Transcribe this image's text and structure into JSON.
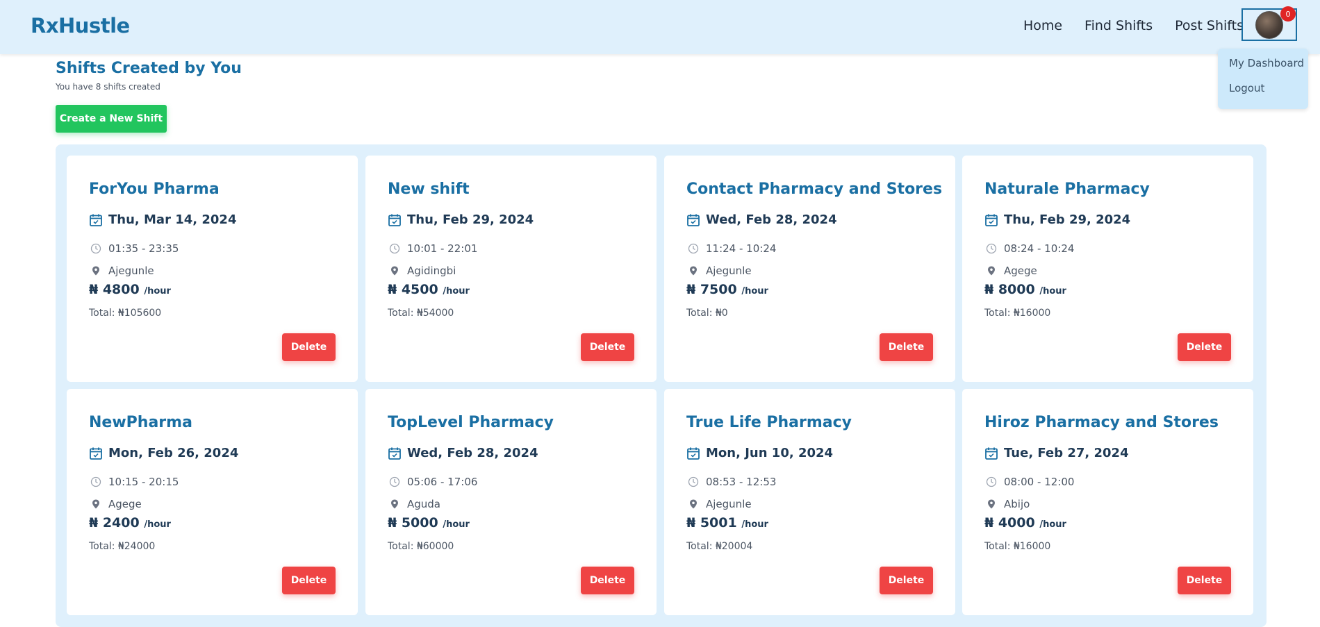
{
  "brand": "RxHustle",
  "nav": {
    "links": [
      "Home",
      "Find Shifts",
      "Post Shifts"
    ],
    "notification_count": "0"
  },
  "dropdown": {
    "items": [
      "My Dashboard",
      "Logout"
    ]
  },
  "page": {
    "title": "Shifts Created by You",
    "subtitle": "You have 8 shifts created",
    "create_button": "Create a New Shift"
  },
  "card_labels": {
    "per_hour": "/hour",
    "delete": "Delete"
  },
  "shifts": [
    {
      "name": "ForYou Pharma",
      "date": "Thu, Mar 14, 2024",
      "time": "01:35 - 23:35",
      "location": "Ajegunle",
      "rate": "₦ 4800",
      "total": "Total: ₦105600"
    },
    {
      "name": "New shift",
      "date": "Thu, Feb 29, 2024",
      "time": "10:01 - 22:01",
      "location": "Agidingbi",
      "rate": "₦ 4500",
      "total": "Total: ₦54000"
    },
    {
      "name": "Contact Pharmacy and Stores",
      "date": "Wed, Feb 28, 2024",
      "time": "11:24 - 10:24",
      "location": "Ajegunle",
      "rate": "₦ 7500",
      "total": "Total: ₦0"
    },
    {
      "name": "Naturale Pharmacy",
      "date": "Thu, Feb 29, 2024",
      "time": "08:24 - 10:24",
      "location": "Agege",
      "rate": "₦ 8000",
      "total": "Total: ₦16000"
    },
    {
      "name": "NewPharma",
      "date": "Mon, Feb 26, 2024",
      "time": "10:15 - 20:15",
      "location": "Agege",
      "rate": "₦ 2400",
      "total": "Total: ₦24000"
    },
    {
      "name": "TopLevel Pharmacy",
      "date": "Wed, Feb 28, 2024",
      "time": "05:06 - 17:06",
      "location": "Aguda",
      "rate": "₦ 5000",
      "total": "Total: ₦60000"
    },
    {
      "name": "True Life Pharmacy",
      "date": "Mon, Jun 10, 2024",
      "time": "08:53 - 12:53",
      "location": "Ajegunle",
      "rate": "₦ 5001",
      "total": "Total: ₦20004"
    },
    {
      "name": "Hiroz Pharmacy and Stores",
      "date": "Tue, Feb 27, 2024",
      "time": "08:00 - 12:00",
      "location": "Abijo",
      "rate": "₦ 4000",
      "total": "Total: ₦16000"
    }
  ]
}
